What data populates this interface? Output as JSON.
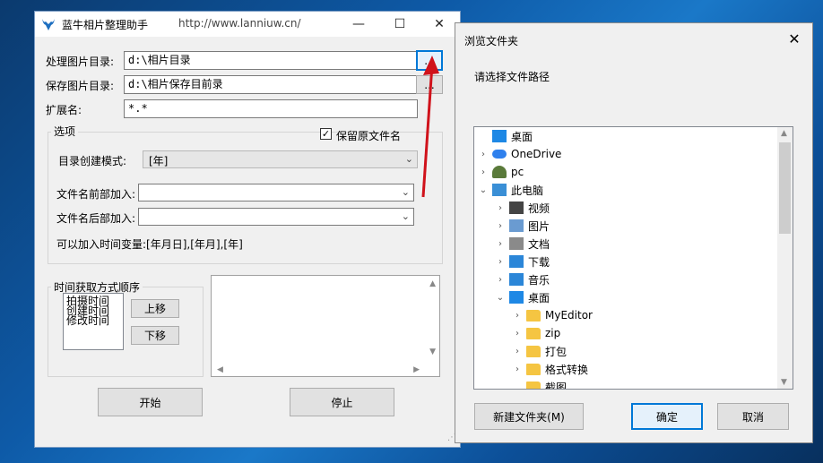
{
  "main_window": {
    "title": "蓝牛相片整理助手",
    "url": "http://www.lanniuw.cn/",
    "source_dir_label": "处理图片目录:",
    "source_dir_value": "d:\\相片目录",
    "browse_label": "...",
    "save_dir_label": "保存图片目录:",
    "save_dir_value": "d:\\相片保存目前录",
    "ext_label": "扩展名:",
    "ext_value": "*.*",
    "options_group": "选项",
    "keep_name_label": "保留原文件名",
    "keep_name_checked": true,
    "dir_mode_label": "目录创建模式:",
    "dir_mode_value": "[年]",
    "prefix_label": "文件名前部加入:",
    "prefix_value": "",
    "suffix_label": "文件名后部加入:",
    "suffix_value": "",
    "time_var_hint": "可以加入时间变量:[年月日],[年月],[年]",
    "time_order_group": "时间获取方式顺序",
    "time_order_items": [
      "拍摄时间",
      "创建时间",
      "修改时间"
    ],
    "move_up": "上移",
    "move_down": "下移",
    "start": "开始",
    "stop": "停止"
  },
  "dialog": {
    "title": "浏览文件夹",
    "prompt": "请选择文件路径",
    "tree": [
      {
        "label": "桌面",
        "icon": "desktop-icon",
        "chevron": ""
      },
      {
        "label": "OneDrive",
        "icon": "cloud-icon",
        "chevron": ">"
      },
      {
        "label": "pc",
        "icon": "user-icon",
        "chevron": ">"
      },
      {
        "label": "此电脑",
        "icon": "computer-icon",
        "chevron": "v"
      },
      {
        "label": "视频",
        "icon": "video-icon",
        "chevron": ">"
      },
      {
        "label": "图片",
        "icon": "picture-icon",
        "chevron": ">"
      },
      {
        "label": "文档",
        "icon": "document-icon",
        "chevron": ">"
      },
      {
        "label": "下载",
        "icon": "download-icon",
        "chevron": ">"
      },
      {
        "label": "音乐",
        "icon": "music-icon",
        "chevron": ">"
      },
      {
        "label": "桌面",
        "icon": "desktop-icon",
        "chevron": "v"
      },
      {
        "label": "MyEditor",
        "icon": "folder-icon",
        "chevron": ">"
      },
      {
        "label": "zip",
        "icon": "folder-icon",
        "chevron": ">"
      },
      {
        "label": "打包",
        "icon": "folder-icon",
        "chevron": ">"
      },
      {
        "label": "格式转换",
        "icon": "folder-icon",
        "chevron": ">"
      },
      {
        "label": "截图",
        "icon": "folder-icon",
        "chevron": ""
      }
    ],
    "new_folder": "新建文件夹(M)",
    "ok": "确定",
    "cancel": "取消"
  }
}
